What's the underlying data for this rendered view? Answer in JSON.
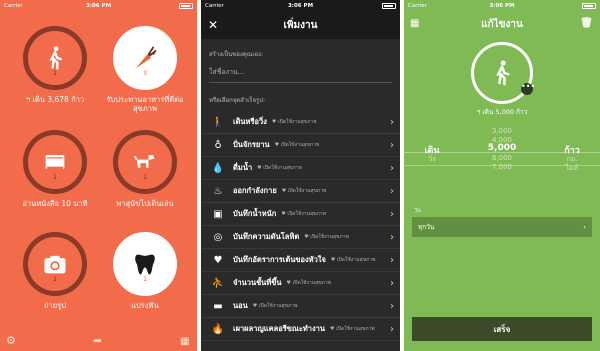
{
  "panel1": {
    "status": {
      "carrier": "Carrier",
      "time": "3:06 PM"
    },
    "habits": [
      {
        "label": "ฯ เดิน 3,678 ก้าว",
        "count": "1",
        "icon": "walking-icon"
      },
      {
        "label": "รับประทานอาหารที่ดีต่อสุขภาพ",
        "count": "3",
        "icon": "carrot-icon"
      },
      {
        "label": "อ่านหนังสือ 10 นาที",
        "count": "1",
        "icon": "book-icon"
      },
      {
        "label": "พาสุนัขไปเดินเล่น",
        "count": "1",
        "icon": "dog-icon"
      },
      {
        "label": "ถ่ายรูป",
        "count": "1",
        "icon": "camera-icon"
      },
      {
        "label": "แปรงฟัน",
        "count": "1",
        "icon": "tooth-icon"
      }
    ],
    "bottom": {
      "settings_icon": "gear-icon",
      "share_icon": "share-icon",
      "calendar_icon": "calendar-icon"
    }
  },
  "panel2": {
    "status": {
      "carrier": "Carrier",
      "time": "3:06 PM"
    },
    "title": "เพิ่มงาน",
    "create_hint": "สร้างเป็นของคุณเอง:",
    "name_placeholder": "ใส่ชื่องาน...",
    "choose_hint": "หรือเลือกจุดสำเร็จรูป:",
    "items": [
      {
        "title": "เดินหรือวิ่ง",
        "sub": "♥ เปิดใช้งานสุขภาพ",
        "icon": "walk-icon"
      },
      {
        "title": "ปั่นจักรยาน",
        "sub": "♥ เปิดใช้งานสุขภาพ",
        "icon": "bike-icon"
      },
      {
        "title": "ดื่มน้ำ",
        "sub": "♥ เปิดใช้งานสุขภาพ",
        "icon": "water-drop-icon"
      },
      {
        "title": "ออกกำลังกาย",
        "sub": "♥ เปิดใช้งานสุขภาพ",
        "icon": "flame-icon"
      },
      {
        "title": "บันทึกน้ำหนัก",
        "sub": "♥ เปิดใช้งานสุขภาพ",
        "icon": "scale-icon"
      },
      {
        "title": "บันทึกความดันโลหิต",
        "sub": "♥ เปิดใช้งานสุขภาพ",
        "icon": "blood-pressure-icon"
      },
      {
        "title": "บันทึกอัตราการเต้นของหัวใจ",
        "sub": "♥ เปิดใช้งานสุขภาพ",
        "icon": "heart-icon"
      },
      {
        "title": "จำนวนชั้นที่ขึ้น",
        "sub": "♥ เปิดใช้งานสุขภาพ",
        "icon": "stairs-icon"
      },
      {
        "title": "นอน",
        "sub": "♥ เปิดใช้งานสุขภาพ",
        "icon": "bed-icon"
      },
      {
        "title": "เผาผลาญแคลอรีขณะทำงาน",
        "sub": "♥ เปิดใช้งานสุขภาพ",
        "icon": "fire-icon"
      }
    ]
  },
  "panel3": {
    "status": {
      "carrier": "Carrier",
      "time": "3:06 PM"
    },
    "title": "แก้ไขงาน",
    "goal_text": "ฯ เดิน 5,000 ก้าว",
    "picker": {
      "left": [
        "",
        "",
        "เดิน",
        "วิ่ง",
        ""
      ],
      "middle": [
        "3,000",
        "4,000",
        "5,000",
        "6,000",
        "7,000"
      ],
      "right": [
        "",
        "",
        "ก้าว",
        "กม.",
        "ไมล์"
      ]
    },
    "when_label": "วัน",
    "when_value": "ทุกวัน",
    "done_label": "เสร็จ"
  }
}
